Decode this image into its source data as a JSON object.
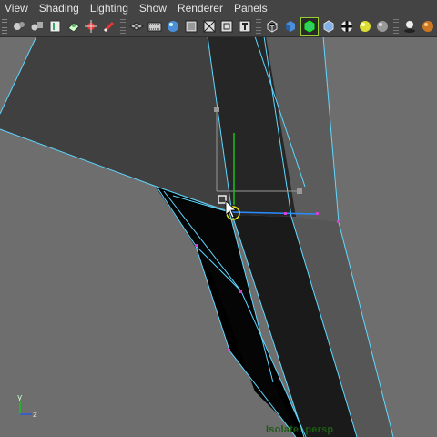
{
  "menu": {
    "items": [
      "View",
      "Shading",
      "Lighting",
      "Show",
      "Renderer",
      "Panels"
    ]
  },
  "toolbar": {
    "icons": [
      "select-camera-icon",
      "camera-attributes-icon",
      "bookmark-icon",
      "image-plane-icon",
      "2d-pan-zoom-icon",
      "grease-pencil-icon",
      "grid-icon",
      "film-gate-icon",
      "resolution-gate-icon",
      "gate-mask-icon",
      "field-chart-icon",
      "safe-action-icon",
      "safe-title-icon",
      "wireframe-icon",
      "smooth-shade-icon",
      "wireframe-on-shaded-icon",
      "xray-icon",
      "checker-icon",
      "default-light-icon",
      "high-quality-icon",
      "shadows-icon",
      "render-icon"
    ]
  },
  "viewport": {
    "camera_label": "Isolate: persp",
    "axis": {
      "y": "y",
      "z": "z"
    },
    "colors": {
      "background": "#6e6e6e",
      "wire": "#5fd7ff",
      "vertex": "#d43fd4",
      "axis_green": "#19c019",
      "axis_blue": "#2a5bd8"
    }
  }
}
